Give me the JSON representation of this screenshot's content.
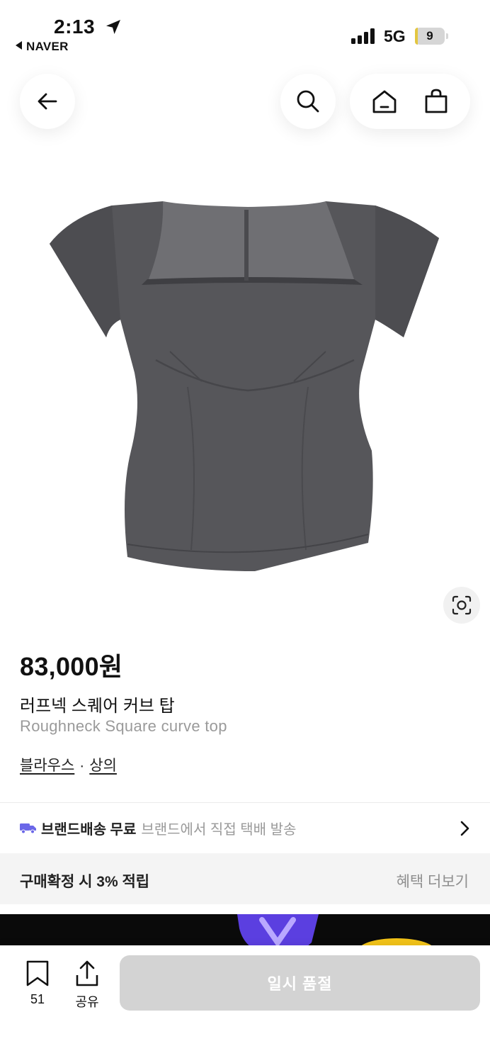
{
  "status_bar": {
    "time": "2:13",
    "back_app": "NAVER",
    "network": "5G",
    "battery": "9",
    "battery_level_percent": 9
  },
  "nav": {
    "back_icon": "arrow-left-icon",
    "search_icon": "search-icon",
    "home_icon": "home-icon",
    "cart_icon": "shopping-bag-icon"
  },
  "product": {
    "price": "83,000원",
    "name_ko": "러프넥 스퀘어 커브 탑",
    "name_en": "Roughneck Square curve top",
    "category_1": "블라우스",
    "category_sep": "·",
    "category_2": "상의",
    "image_colors": {
      "fabric": "#5b5b5f",
      "fabric_dark": "#49494d",
      "lining": "#7a7a7e"
    }
  },
  "shipping": {
    "title": "브랜드배송 무료",
    "detail": "브랜드에서 직접 택배 발송",
    "icon": "truck-icon",
    "icon_color": "#6b67e8"
  },
  "benefit": {
    "text": "구매확정 시 3% 적립",
    "more": "혜택 더보기"
  },
  "bottom_bar": {
    "bookmark_count": "51",
    "share_label": "공유",
    "soldout_label": "일시 품절"
  }
}
